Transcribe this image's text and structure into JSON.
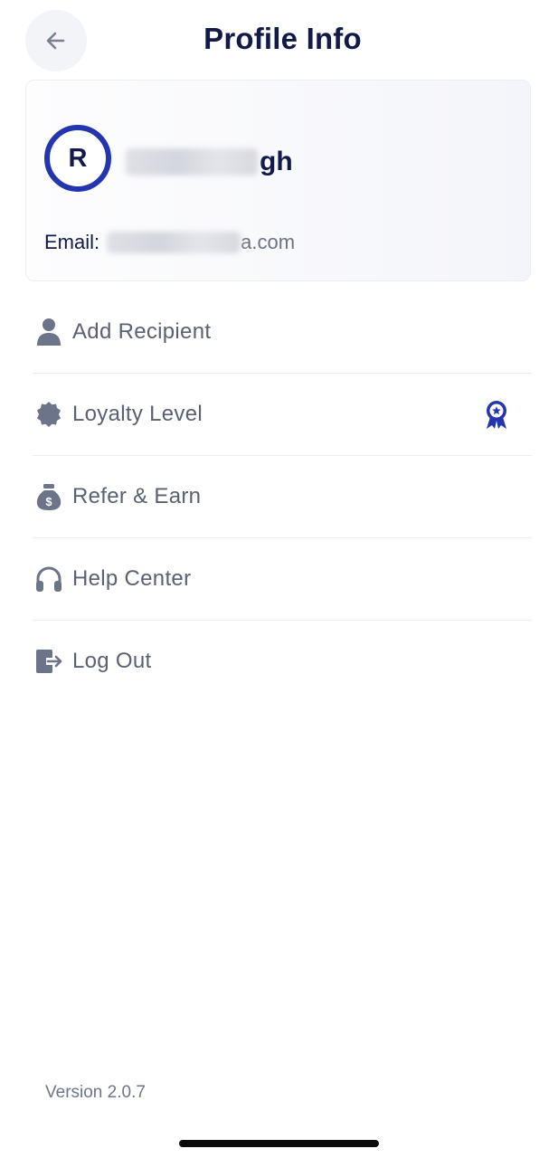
{
  "header": {
    "title": "Profile Info",
    "back_icon": "arrow-left-icon"
  },
  "profile": {
    "avatar_initial": "R",
    "name_visible": "gh",
    "email_label": "Email:",
    "email_visible": "a.com",
    "accent_color": "#2336b0"
  },
  "menu": {
    "items": [
      {
        "label": "Add Recipient",
        "icon": "person-icon"
      },
      {
        "label": "Loyalty Level",
        "icon": "badge-icon",
        "trailing_icon": "award-ribbon-icon"
      },
      {
        "label": "Refer & Earn",
        "icon": "money-bag-icon"
      },
      {
        "label": "Help Center",
        "icon": "headphones-icon"
      },
      {
        "label": "Log Out",
        "icon": "logout-icon"
      }
    ]
  },
  "footer": {
    "version": "Version 2.0.7"
  },
  "colors": {
    "title": "#121a4a",
    "menu_text": "#5a6174",
    "icon": "#6b7489",
    "accent": "#2336b0"
  }
}
